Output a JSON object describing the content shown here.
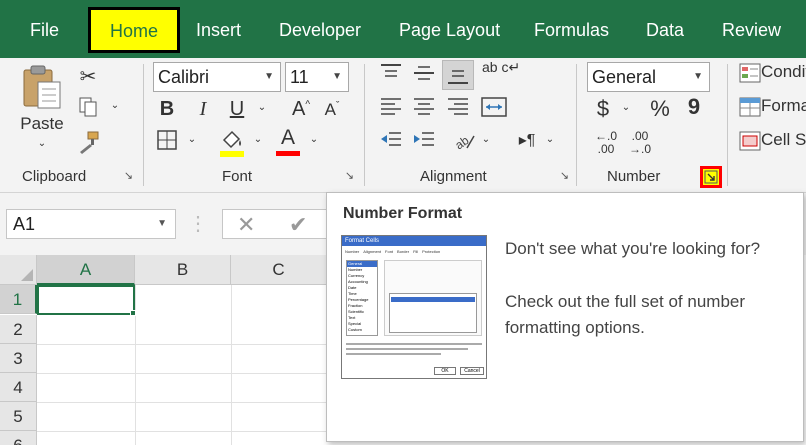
{
  "tabs": [
    "File",
    "Home",
    "Insert",
    "Developer",
    "Page Layout",
    "Formulas",
    "Data",
    "Review"
  ],
  "ribbon": {
    "clipboard": {
      "paste_label": "Paste",
      "group_label": "Clipboard"
    },
    "font": {
      "family": "Calibri",
      "size": "11",
      "group_label": "Font",
      "bold": "B",
      "italic": "I",
      "underline": "U",
      "grow": "A",
      "shrink": "A",
      "font_color_letter": "A",
      "highlight_color": "#ffff00",
      "font_color": "#ff0000"
    },
    "alignment": {
      "group_label": "Alignment",
      "wrap_text_icon": "ab c"
    },
    "number": {
      "format": "General",
      "group_label": "Number",
      "currency": "$",
      "percent": "%",
      "comma": "9",
      "inc_decimal_top": "←.0",
      "inc_decimal_bottom": ".00",
      "dec_decimal_top": ".00",
      "dec_decimal_bottom": "→.0"
    },
    "styles": {
      "conditional": "Conditional Formatting",
      "format_table": "Format as Table",
      "cell_styles": "Cell Styles"
    }
  },
  "formula_bar": {
    "name_box": "A1"
  },
  "grid": {
    "columns": [
      "A",
      "B",
      "C"
    ],
    "rows": [
      "1",
      "2",
      "3",
      "4",
      "5",
      "6"
    ]
  },
  "tooltip": {
    "title": "Number Format",
    "line1": "Don't see what you're looking for?",
    "line2": "Check out the full set of number formatting options.",
    "preview": {
      "dialog_title": "Format Cells",
      "tabs": [
        "Number",
        "Alignment",
        "Font",
        "Border",
        "Fill",
        "Protection"
      ],
      "categories": [
        "General",
        "Number",
        "Currency",
        "Accounting",
        "Date",
        "Time",
        "Percentage",
        "Fraction",
        "Scientific",
        "Text",
        "Special",
        "Custom"
      ],
      "ok": "OK",
      "cancel": "Cancel"
    }
  },
  "colors": {
    "accent": "#217346",
    "highlight": "#ffff00",
    "launcher_highlight": "#ff0000"
  }
}
